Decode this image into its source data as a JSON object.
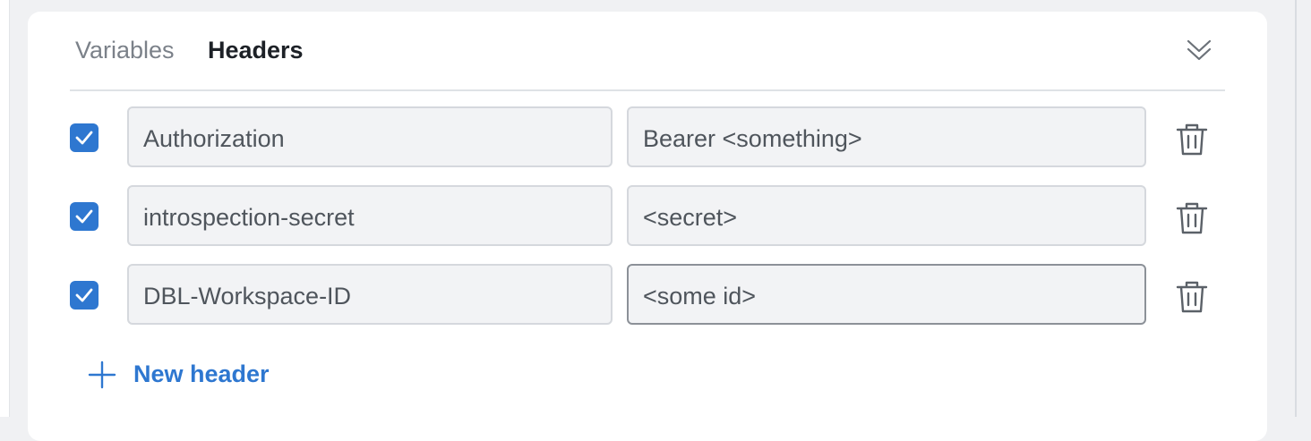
{
  "tabs": [
    {
      "label": "Variables",
      "active": false
    },
    {
      "label": "Headers",
      "active": true
    }
  ],
  "headers": [
    {
      "enabled": true,
      "key": "Authorization",
      "value": "Bearer <something>"
    },
    {
      "enabled": true,
      "key": "introspection-secret",
      "value": "<secret>"
    },
    {
      "enabled": true,
      "key": "DBL-Workspace-ID",
      "value": "<some id>"
    }
  ],
  "new_header_label": "New header",
  "icons": {
    "collapse": "chevrons-down-icon",
    "checkbox": "check-icon",
    "delete": "trash-icon",
    "add": "plus-icon"
  },
  "colors": {
    "accent": "#2e77d0",
    "active_tab": "#1d2127",
    "inactive_tab": "#7b8189",
    "field_bg": "#f2f3f5"
  }
}
